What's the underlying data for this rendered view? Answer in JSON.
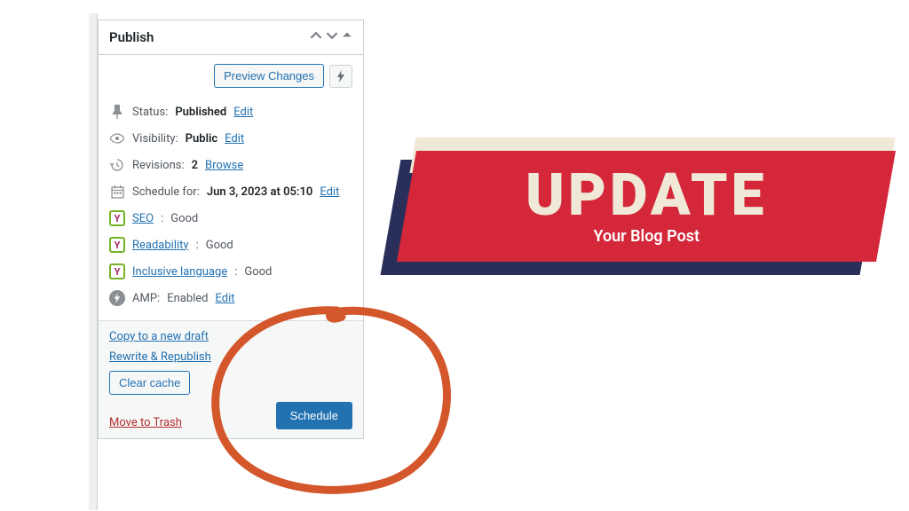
{
  "panel": {
    "title": "Publish",
    "preview_button": "Preview Changes",
    "status": {
      "label": "Status:",
      "value": "Published",
      "edit": "Edit"
    },
    "visibility": {
      "label": "Visibility:",
      "value": "Public",
      "edit": "Edit"
    },
    "revisions": {
      "label": "Revisions:",
      "value": "2",
      "browse": "Browse"
    },
    "schedule": {
      "label": "Schedule for:",
      "value": "Jun 3, 2023 at 05:10",
      "edit": "Edit"
    },
    "seo": {
      "label": "SEO",
      "value": "Good"
    },
    "readability": {
      "label": "Readability",
      "value": "Good"
    },
    "inclusive": {
      "label": "Inclusive language",
      "value": "Good"
    },
    "amp": {
      "label": "AMP:",
      "value": "Enabled",
      "edit": "Edit"
    },
    "copy_draft": "Copy to a new draft",
    "rewrite": "Rewrite & Republish",
    "clear_cache": "Clear cache",
    "trash": "Move to Trash",
    "schedule_btn": "Schedule"
  },
  "banner": {
    "title": "UPDATE",
    "subtitle": "Your Blog Post"
  }
}
